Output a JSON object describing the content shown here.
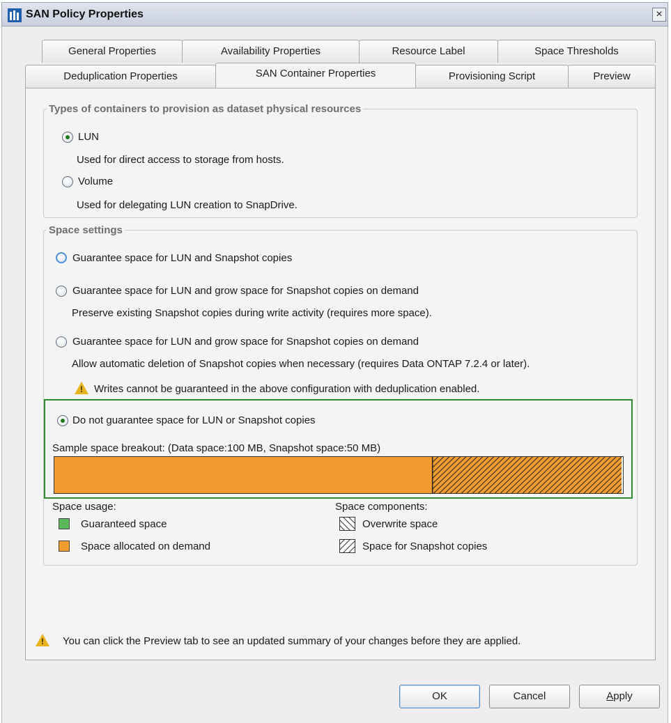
{
  "window": {
    "title": "SAN Policy Properties",
    "close_glyph": "×"
  },
  "tabs": {
    "row1": [
      {
        "label": "General Properties"
      },
      {
        "label": "Availability Properties"
      },
      {
        "label": "Resource Label"
      },
      {
        "label": "Space Thresholds"
      }
    ],
    "row2": [
      {
        "label": "Deduplication Properties"
      },
      {
        "label": "SAN Container Properties",
        "active": true
      },
      {
        "label": "Provisioning Script"
      },
      {
        "label": "Preview"
      }
    ]
  },
  "containers": {
    "legend": "Types of containers to provision as dataset physical resources",
    "options": [
      {
        "label": "LUN",
        "description": "Used for direct access to storage from hosts.",
        "selected": true
      },
      {
        "label": "Volume",
        "description": "Used for delegating LUN creation to SnapDrive.",
        "selected": false
      }
    ]
  },
  "space_settings": {
    "legend": "Space settings",
    "options": [
      {
        "label": "Guarantee space for LUN and Snapshot copies",
        "selected": false
      },
      {
        "label": "Guarantee space for LUN and grow space for Snapshot copies on demand",
        "description": "Preserve existing Snapshot copies during write activity (requires more space).",
        "selected": false
      },
      {
        "label": "Guarantee space for LUN and grow space for Snapshot copies on demand",
        "description": "Allow automatic deletion of Snapshot copies when necessary (requires Data ONTAP 7.2.4 or later).",
        "selected": false
      },
      {
        "label": "Do not guarantee space for LUN or Snapshot copies",
        "selected": true
      }
    ],
    "warning": "Writes cannot be guaranteed in the above configuration with deduplication enabled.",
    "breakout_label": "Sample space breakout: (Data space:100 MB, Snapshot space:50 MB)",
    "breakout": {
      "data_mb": 100,
      "snapshot_mb": 50
    }
  },
  "legend": {
    "usage_title": "Space usage:",
    "usage_items": [
      {
        "label": "Guaranteed space",
        "color": "#5cb85c"
      },
      {
        "label": "Space allocated on demand",
        "color": "#f29b30"
      }
    ],
    "components_title": "Space components:",
    "component_items": [
      {
        "label": "Overwrite space",
        "pattern": "backslash-hatch"
      },
      {
        "label": "Space for Snapshot copies",
        "pattern": "slash-hatch"
      }
    ]
  },
  "footer_note": "You can click the Preview tab to see an updated summary of your changes before they are applied.",
  "buttons": {
    "ok": "OK",
    "cancel": "Cancel",
    "apply": "Apply"
  },
  "colors": {
    "on_demand": "#f29b30",
    "guaranteed": "#5cb85c",
    "highlight": "#2f8a2f"
  }
}
